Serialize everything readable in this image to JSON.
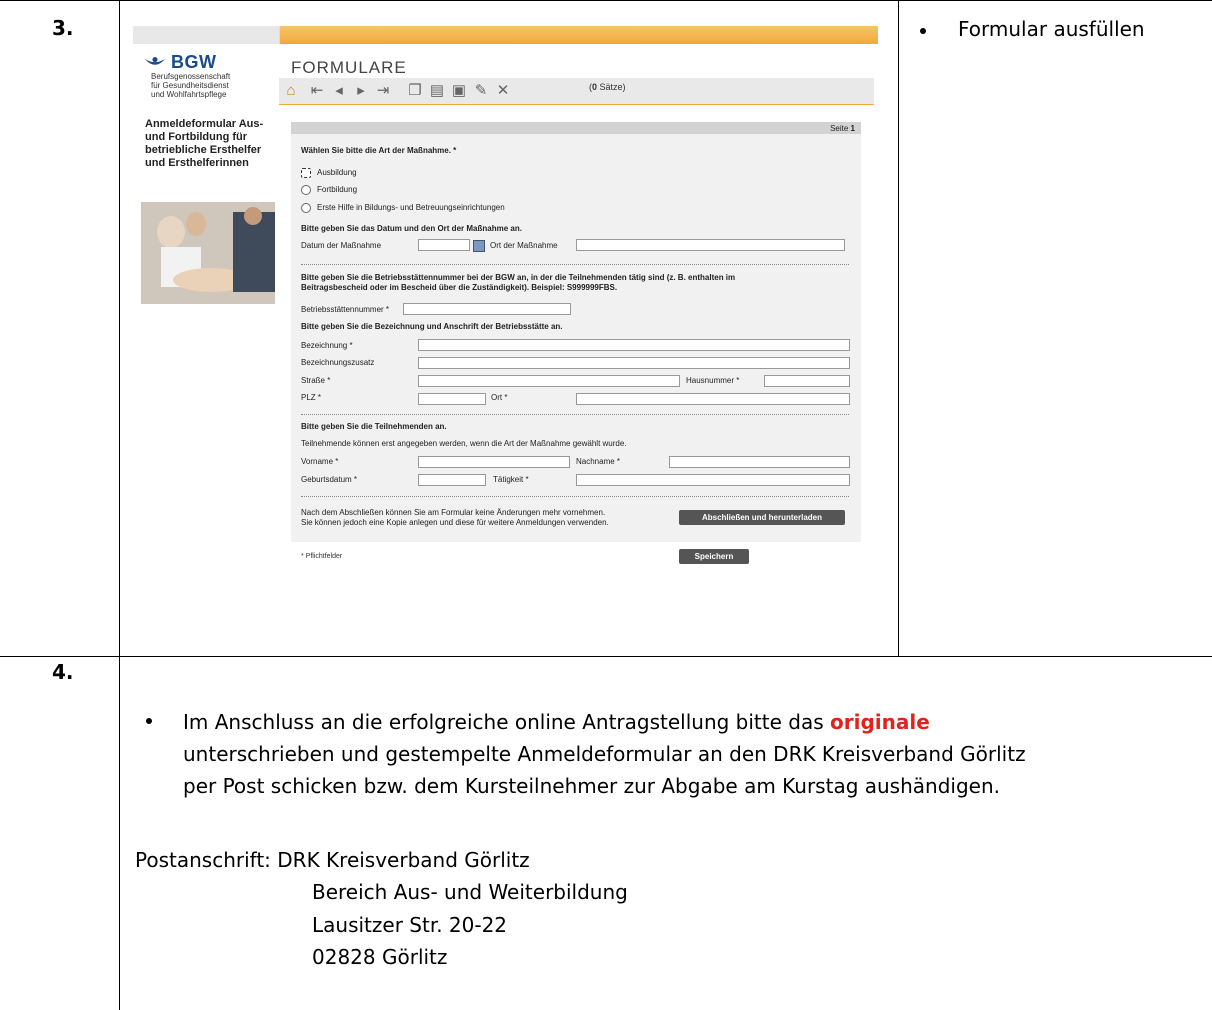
{
  "steps": {
    "step3": "3.",
    "step4": "4."
  },
  "step3_right": {
    "bullet_text": "Formular ausfüllen"
  },
  "screenshot": {
    "logo_name": "BGW",
    "logo_sub_1": "Berufsgenossenschaft",
    "logo_sub_2": "für Gesundheitsdienst",
    "logo_sub_3": "und Wohlfahrtspflege",
    "form_title": "FORMULARE",
    "count_num": "0",
    "count_label": "Sätze)",
    "count_open": "(",
    "side_title": "Anmeldeformular Aus- und Fortbildung für betriebliche Ersthelfer und Ersthelferinnen",
    "seite_label": "Seite",
    "seite_num": "1",
    "q1": "Wählen Sie bitte die Art der Maßnahme. *",
    "opt1": "Ausbildung",
    "opt2": "Fortbildung",
    "opt3": "Erste Hilfe in Bildungs- und Betreuungseinrichtungen",
    "q2": "Bitte geben Sie das Datum und den Ort der Maßnahme an.",
    "datum_label": "Datum der Maßnahme",
    "ort_label": "Ort der Maßnahme",
    "q3a": "Bitte geben Sie die Betriebsstättennummer bei der BGW an, in der die Teilnehmenden tätig sind (z. B. enthalten im",
    "q3b": "Beitragsbescheid oder im Bescheid über die Zuständigkeit). Beispiel: S999999FBS.",
    "bsn_label": "Betriebsstättennummer *",
    "q4": "Bitte geben Sie die Bezeichnung und Anschrift der Betriebsstätte an.",
    "bez_label": "Bezeichnung *",
    "bezz_label": "Bezeichnungszusatz",
    "str_label": "Straße *",
    "hnr_label": "Hausnummer *",
    "plz_label": "PLZ *",
    "ort2_label": "Ort *",
    "q5": "Bitte geben Sie die Teilnehmenden an.",
    "q5_note": "Teilnehmende können erst angegeben werden, wenn die Art der Maßnahme gewählt wurde.",
    "vorname_label": "Vorname *",
    "nachname_label": "Nachname *",
    "geb_label": "Geburtsdatum *",
    "taet_label": "Tätigkeit *",
    "final_note_1": "Nach dem Abschließen können Sie am Formular keine Änderungen mehr vornehmen.",
    "final_note_2": "Sie können jedoch eine Kopie anlegen und diese für weitere Anmeldungen verwenden.",
    "btn_finish": "Abschließen und herunterladen",
    "pflicht": "* Pflichtfelder",
    "btn_save": "Speichern"
  },
  "step4_text": {
    "line1_pre": "Im Anschluss an die erfolgreiche online Antragstellung bitte das",
    "line1_red": "originale",
    "line2": "unterschrieben und gestempelte Anmeldeformular an den DRK Kreisverband Görlitz",
    "line3": "per Post schicken bzw. dem Kursteilnehmer zur Abgabe am Kurstag aushändigen."
  },
  "address": {
    "label": "Postanschrift: DRK Kreisverband Görlitz",
    "line2": "Bereich Aus- und Weiterbildung",
    "line3": "Lausitzer Str. 20-22",
    "line4": "02828 Görlitz"
  },
  "colors": {
    "accent_orange": "#f0a93a",
    "highlight_red": "#e0241b",
    "bgw_blue": "#1a4b8c"
  }
}
